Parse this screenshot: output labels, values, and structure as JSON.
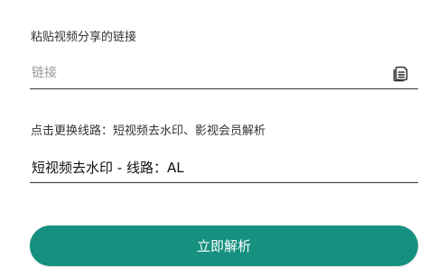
{
  "link_section": {
    "label": "粘贴视频分享的链接",
    "input": {
      "placeholder": "链接",
      "value": ""
    },
    "paste_icon": "paste-clipboard-icon"
  },
  "route_section": {
    "label": "点击更换线路：短视频去水印、影视会员解析",
    "selected": "短视频去水印 - 线路：AL"
  },
  "parse_button": {
    "label": "立即解析",
    "color": "#16907f"
  }
}
